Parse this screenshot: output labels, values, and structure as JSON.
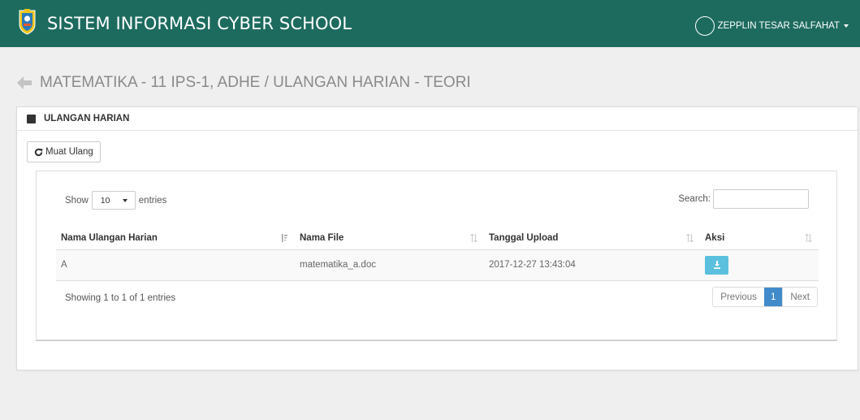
{
  "header": {
    "title": "SISTEM INFORMASI CYBER SCHOOL",
    "user_name": "ZEPPLIN TESAR SALFAHAT",
    "bar_color": "#1d6b5f"
  },
  "page": {
    "title": "MATEMATIKA - 11 IPS-1, ADHE / ULANGAN HARIAN - TEORI"
  },
  "portlet": {
    "title": "ULANGAN HARIAN",
    "reload_label": "Muat Ulang"
  },
  "table": {
    "show_label": "Show",
    "length_value": "10",
    "entries_label": "entries",
    "search_label": "Search:",
    "search_value": "",
    "columns": [
      "Nama Ulangan Harian",
      "Nama File",
      "Tanggal Upload",
      "Aksi"
    ],
    "rows": [
      [
        "A",
        "matematika_a.doc",
        "2017-12-27 13:43:04"
      ]
    ],
    "info": "Showing 1 to 1 of 1 entries",
    "pagination": {
      "previous": "Previous",
      "current": "1",
      "next": "Next"
    },
    "action_color": "#5bc0de",
    "active_page_color": "#428bca"
  },
  "icons": {
    "logo": "school-crest-icon",
    "back": "arrow-left-icon",
    "portlet": "book-icon",
    "reload": "refresh-icon",
    "download": "download-icon"
  }
}
